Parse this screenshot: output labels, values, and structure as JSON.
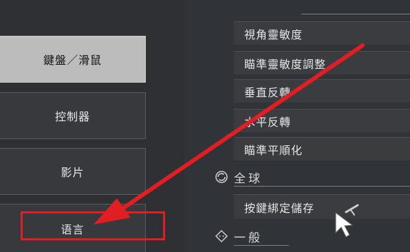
{
  "left_menu": {
    "items": [
      {
        "label": "鍵盤／滑鼠",
        "active": true
      },
      {
        "label": "控制器",
        "active": false
      },
      {
        "label": "影片",
        "active": false
      },
      {
        "label": "语言",
        "active": false
      }
    ]
  },
  "settings": {
    "rows": [
      "視角靈敏度",
      "瞄準靈敏度調整",
      "垂直反轉",
      "水平反轉",
      "瞄準平順化"
    ],
    "global_section": {
      "title": "全球",
      "icon": "globe-icon"
    },
    "keybind_row": "按鍵綁定儲存",
    "general_section": {
      "title": "一般",
      "icon": "diamond-icon"
    }
  },
  "annotation": {
    "color": "#e01e24"
  }
}
